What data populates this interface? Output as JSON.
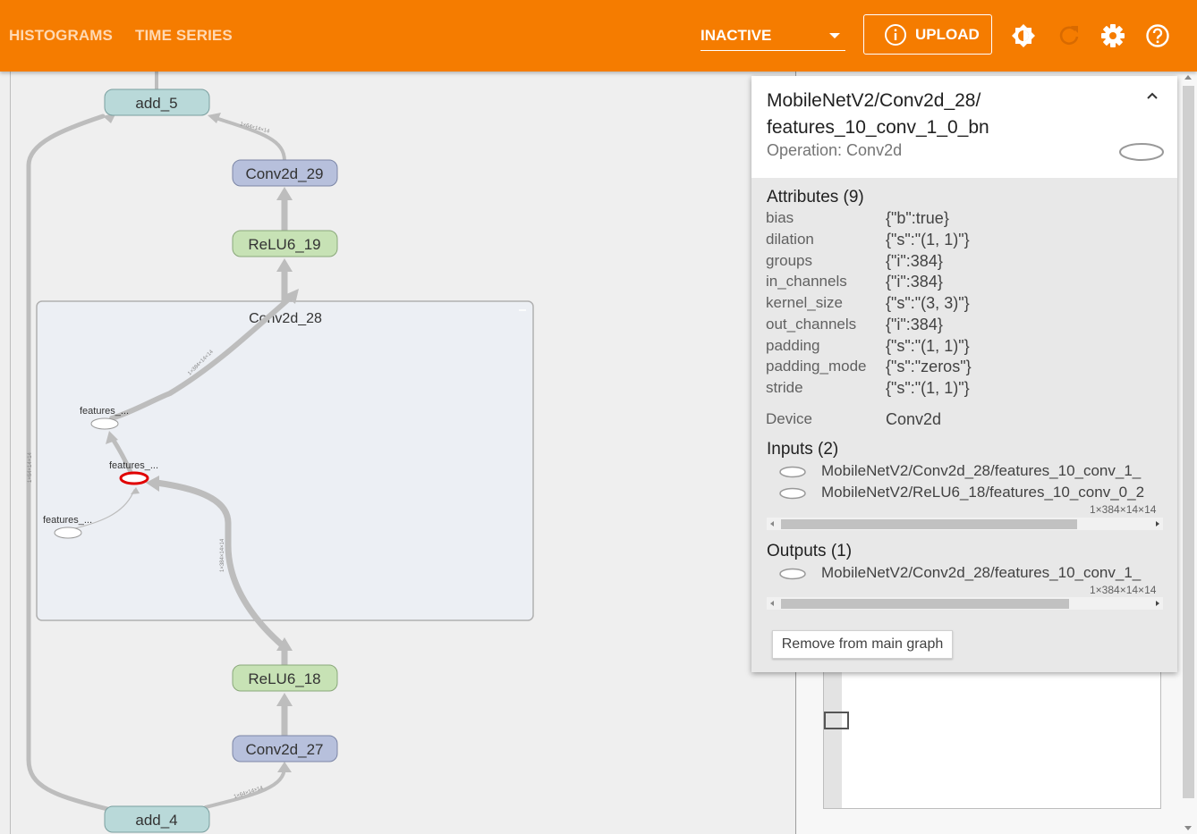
{
  "header": {
    "tabs": [
      {
        "label": "HISTOGRAMS"
      },
      {
        "label": "TIME SERIES"
      }
    ],
    "run_selector": {
      "value": "INACTIVE"
    },
    "upload_label": "UPLOAD",
    "icons": [
      "info-icon",
      "brightness-icon",
      "refresh-icon",
      "settings-icon",
      "help-icon"
    ],
    "bar_color": "#f57c00"
  },
  "graph": {
    "nodes": {
      "add_5": "add_5",
      "conv2d_29": "Conv2d_29",
      "relu6_19": "ReLU6_19",
      "conv2d_28": "Conv2d_28",
      "relu6_18": "ReLU6_18",
      "conv2d_27": "Conv2d_27",
      "add_4": "add_4",
      "inner_1": "features_...",
      "inner_2": "features_...",
      "inner_3": "features_..."
    },
    "colors": {
      "add_fill": "#b9d9d9",
      "conv_fill": "#b7c0dc",
      "relu_fill": "#c7e2b5",
      "selected": "#e00000"
    }
  },
  "info": {
    "title_line1": "MobileNetV2/Conv2d_28/",
    "title_line2": "features_10_conv_1_0_bn",
    "operation": "Operation: Conv2d",
    "attributes_title": "Attributes (9)",
    "attributes": [
      {
        "key": "bias",
        "value": "{\"b\":true}"
      },
      {
        "key": "dilation",
        "value": "{\"s\":\"(1, 1)\"}"
      },
      {
        "key": "groups",
        "value": "{\"i\":384}"
      },
      {
        "key": "in_channels",
        "value": "{\"i\":384}"
      },
      {
        "key": "kernel_size",
        "value": "{\"s\":\"(3, 3)\"}"
      },
      {
        "key": "out_channels",
        "value": "{\"i\":384}"
      },
      {
        "key": "padding",
        "value": "{\"s\":\"(1, 1)\"}"
      },
      {
        "key": "padding_mode",
        "value": "{\"s\":\"zeros\"}"
      },
      {
        "key": "stride",
        "value": "{\"s\":\"(1, 1)\"}"
      }
    ],
    "device_key": "Device",
    "device_value": "Conv2d",
    "inputs_title": "Inputs (2)",
    "inputs": [
      {
        "name": "MobileNetV2/Conv2d_28/features_10_conv_1_"
      },
      {
        "name": "MobileNetV2/ReLU6_18/features_10_conv_0_2",
        "dims": "1×384×14×14"
      }
    ],
    "outputs_title": "Outputs (1)",
    "outputs": [
      {
        "name": "MobileNetV2/Conv2d_28/features_10_conv_1_",
        "dims": "1×384×14×14"
      }
    ],
    "remove_button": "Remove from main graph"
  }
}
